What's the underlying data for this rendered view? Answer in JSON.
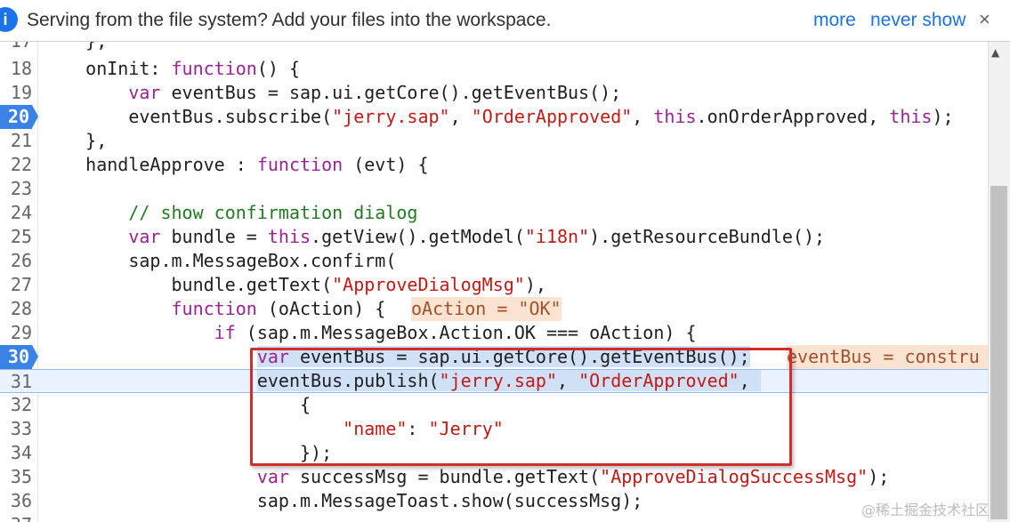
{
  "infobar": {
    "icon": "info-icon",
    "message": "Serving from the file system? Add your files into the workspace.",
    "more_label": "more",
    "never_show_label": "never show",
    "close_label": "×"
  },
  "editor": {
    "lines": [
      {
        "num": "17",
        "text": "    },"
      },
      {
        "num": "18",
        "text": "    onInit: function() {"
      },
      {
        "num": "19",
        "text": "        var eventBus = sap.ui.getCore().getEventBus();"
      },
      {
        "num": "20",
        "text": "        eventBus.subscribe(\"jerry.sap\", \"OrderApproved\", this.onOrderApproved, this);",
        "breakpoint": true
      },
      {
        "num": "21",
        "text": "    },"
      },
      {
        "num": "22",
        "text": "    handleApprove : function (evt) {"
      },
      {
        "num": "23",
        "text": ""
      },
      {
        "num": "24",
        "text": "        // show confirmation dialog"
      },
      {
        "num": "25",
        "text": "        var bundle = this.getView().getModel(\"i18n\").getResourceBundle();"
      },
      {
        "num": "26",
        "text": "        sap.m.MessageBox.confirm("
      },
      {
        "num": "27",
        "text": "            bundle.getText(\"ApproveDialogMsg\"),"
      },
      {
        "num": "28",
        "text": "            function (oAction) {",
        "inline": "oAction = \"OK\""
      },
      {
        "num": "29",
        "text": "                if (sap.m.MessageBox.Action.OK === oAction) {"
      },
      {
        "num": "30",
        "text": "                    var eventBus = sap.ui.getCore().getEventBus();",
        "breakpoint": true,
        "inline": "eventBus = constru"
      },
      {
        "num": "31",
        "text": "                    eventBus.publish(\"jerry.sap\", \"OrderApproved\",",
        "current": true
      },
      {
        "num": "32",
        "text": "                        {"
      },
      {
        "num": "33",
        "text": "                            \"name\": \"Jerry\""
      },
      {
        "num": "34",
        "text": "                        });"
      },
      {
        "num": "35",
        "text": "                    var successMsg = bundle.getText(\"ApproveDialogSuccessMsg\");"
      },
      {
        "num": "36",
        "text": "                    sap.m.MessageToast.show(successMsg);"
      },
      {
        "num": "37",
        "text": ""
      }
    ]
  },
  "watermark": "@稀土掘金技术社区",
  "colors": {
    "accent": "#1a73e8",
    "breakpoint": "#3b82e6",
    "keyword": "#9b2393",
    "string": "#c41a16",
    "comment": "#237a23",
    "highlight_box": "#d62b2b",
    "inline_value_bg": "#fbe3d2"
  }
}
